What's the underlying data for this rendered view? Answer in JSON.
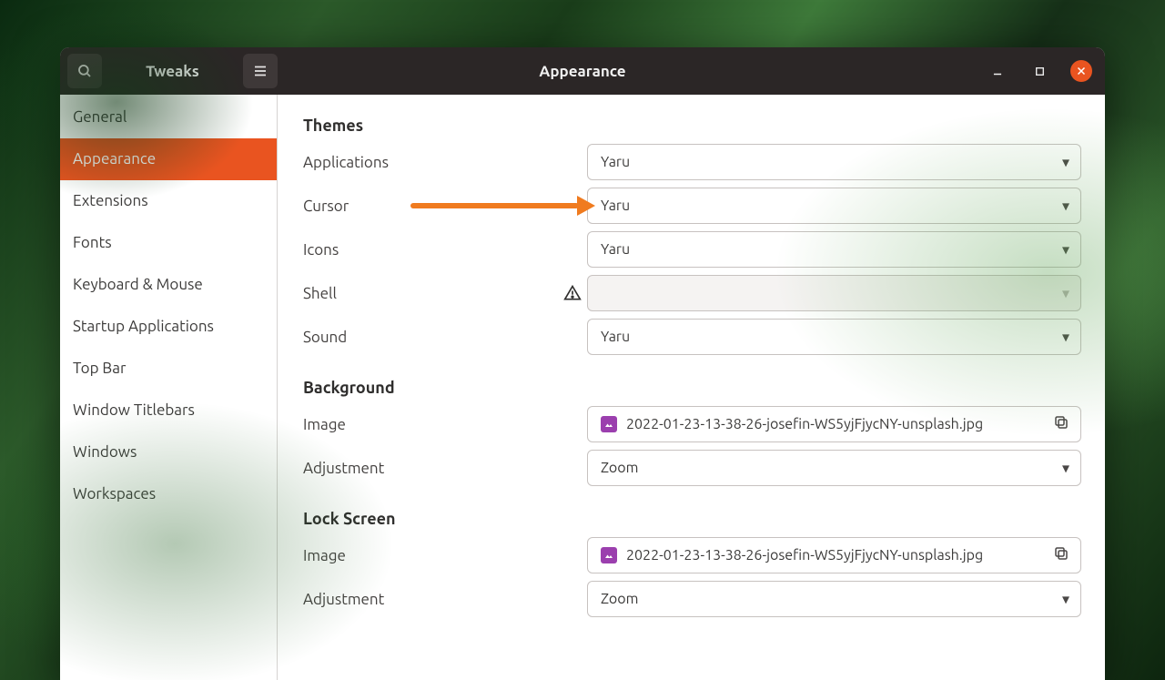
{
  "header": {
    "app_title": "Tweaks",
    "page_title": "Appearance",
    "icons": {
      "search": "search-icon",
      "menu": "hamburger-icon"
    }
  },
  "sidebar": {
    "items": [
      {
        "label": "General",
        "active": false
      },
      {
        "label": "Appearance",
        "active": true
      },
      {
        "label": "Extensions",
        "active": false
      },
      {
        "label": "Fonts",
        "active": false
      },
      {
        "label": "Keyboard & Mouse",
        "active": false
      },
      {
        "label": "Startup Applications",
        "active": false
      },
      {
        "label": "Top Bar",
        "active": false
      },
      {
        "label": "Window Titlebars",
        "active": false
      },
      {
        "label": "Windows",
        "active": false
      },
      {
        "label": "Workspaces",
        "active": false
      }
    ]
  },
  "sections": {
    "themes": {
      "title": "Themes",
      "rows": {
        "applications": {
          "label": "Applications",
          "value": "Yaru"
        },
        "cursor": {
          "label": "Cursor",
          "value": "Yaru"
        },
        "icons": {
          "label": "Icons",
          "value": "Yaru"
        },
        "shell": {
          "label": "Shell",
          "value": "",
          "disabled": true,
          "warning": true
        },
        "sound": {
          "label": "Sound",
          "value": "Yaru"
        }
      }
    },
    "background": {
      "title": "Background",
      "rows": {
        "image": {
          "label": "Image",
          "value": "2022-01-23-13-38-26-josefin-WS5yjFjycNY-unsplash.jpg"
        },
        "adjustment": {
          "label": "Adjustment",
          "value": "Zoom"
        }
      }
    },
    "lockscreen": {
      "title": "Lock Screen",
      "rows": {
        "image": {
          "label": "Image",
          "value": "2022-01-23-13-38-26-josefin-WS5yjFjycNY-unsplash.jpg"
        },
        "adjustment": {
          "label": "Adjustment",
          "value": "Zoom"
        }
      }
    }
  },
  "annotation": {
    "arrow_color": "#f07b1f"
  },
  "colors": {
    "accent": "#e95420"
  }
}
